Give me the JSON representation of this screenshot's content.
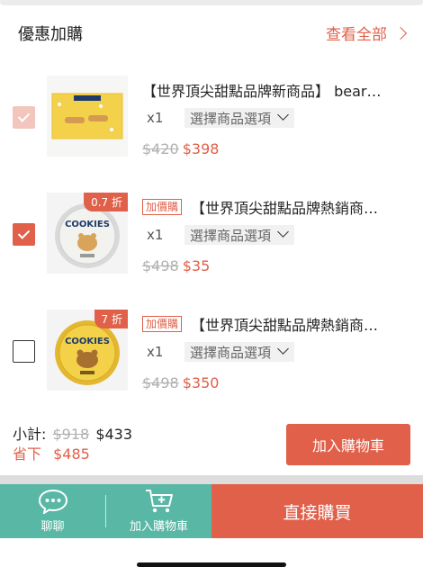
{
  "header": {
    "title": "優惠加購",
    "view_all": "查看全部"
  },
  "items": [
    {
      "title": "【世界頂尖甜點品牌新商品】 bear…",
      "badge": "",
      "discount_tag": "",
      "qty": "x1",
      "variant": "選擇商品選項",
      "old_price": "$420",
      "new_price": "$398",
      "checked": true,
      "disabled": true
    },
    {
      "title": "【世界頂尖甜點品牌熱銷商…",
      "badge": "加價購",
      "discount_tag": "0.7 折",
      "qty": "x1",
      "variant": "選擇商品選項",
      "old_price": "$498",
      "new_price": "$35",
      "checked": true,
      "disabled": false
    },
    {
      "title": "【世界頂尖甜點品牌熱銷商…",
      "badge": "加價購",
      "discount_tag": "7 折",
      "qty": "x1",
      "variant": "選擇商品選項",
      "old_price": "$498",
      "new_price": "$350",
      "checked": false,
      "disabled": false
    }
  ],
  "summary": {
    "subtotal_label": "小計:",
    "subtotal_old": "$918",
    "subtotal_new": "$433",
    "save_label": "省下",
    "save_value": "$485"
  },
  "add_to_cart_button": "加入購物車",
  "bottom_bar": {
    "chat_label": "聊聊",
    "cart_label": "加入購物車",
    "buy_label": "直接購買"
  },
  "thumb_texts": {
    "cookies": "COOKIES"
  },
  "colors": {
    "accent": "#e0604a",
    "green": "#59b7a5",
    "accent_light": "#f2c6bd"
  }
}
